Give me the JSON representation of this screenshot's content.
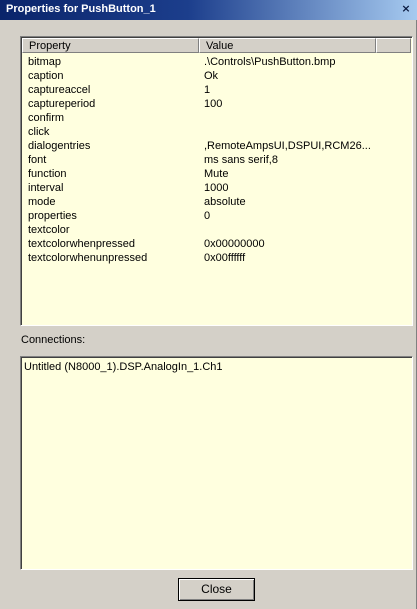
{
  "window": {
    "title": "Properties for PushButton_1",
    "close_glyph": "×"
  },
  "properties_table": {
    "columns": [
      "Property",
      "Value",
      ""
    ],
    "rows": [
      {
        "property": "bitmap",
        "value": ".\\Controls\\PushButton.bmp"
      },
      {
        "property": "caption",
        "value": "Ok"
      },
      {
        "property": "captureaccel",
        "value": "1"
      },
      {
        "property": "captureperiod",
        "value": "100"
      },
      {
        "property": "confirm",
        "value": ""
      },
      {
        "property": "click",
        "value": ""
      },
      {
        "property": "dialogentries",
        "value": ",RemoteAmpsUI,DSPUI,RCM26..."
      },
      {
        "property": "font",
        "value": "ms sans serif,8"
      },
      {
        "property": "function",
        "value": "Mute"
      },
      {
        "property": "interval",
        "value": "1000"
      },
      {
        "property": "mode",
        "value": "absolute"
      },
      {
        "property": "properties",
        "value": "0"
      },
      {
        "property": "textcolor",
        "value": ""
      },
      {
        "property": "textcolorwhenpressed",
        "value": "0x00000000"
      },
      {
        "property": "textcolorwhenunpressed",
        "value": "0x00ffffff"
      }
    ]
  },
  "connections": {
    "label": "Connections:",
    "items": [
      "Untitled (N8000_1).DSP.AnalogIn_1.Ch1"
    ]
  },
  "buttons": {
    "close": "Close"
  },
  "colors": {
    "list_background": "#ffffdf",
    "dialog_face": "#d4d0c8",
    "titlebar": "#0a246a"
  }
}
